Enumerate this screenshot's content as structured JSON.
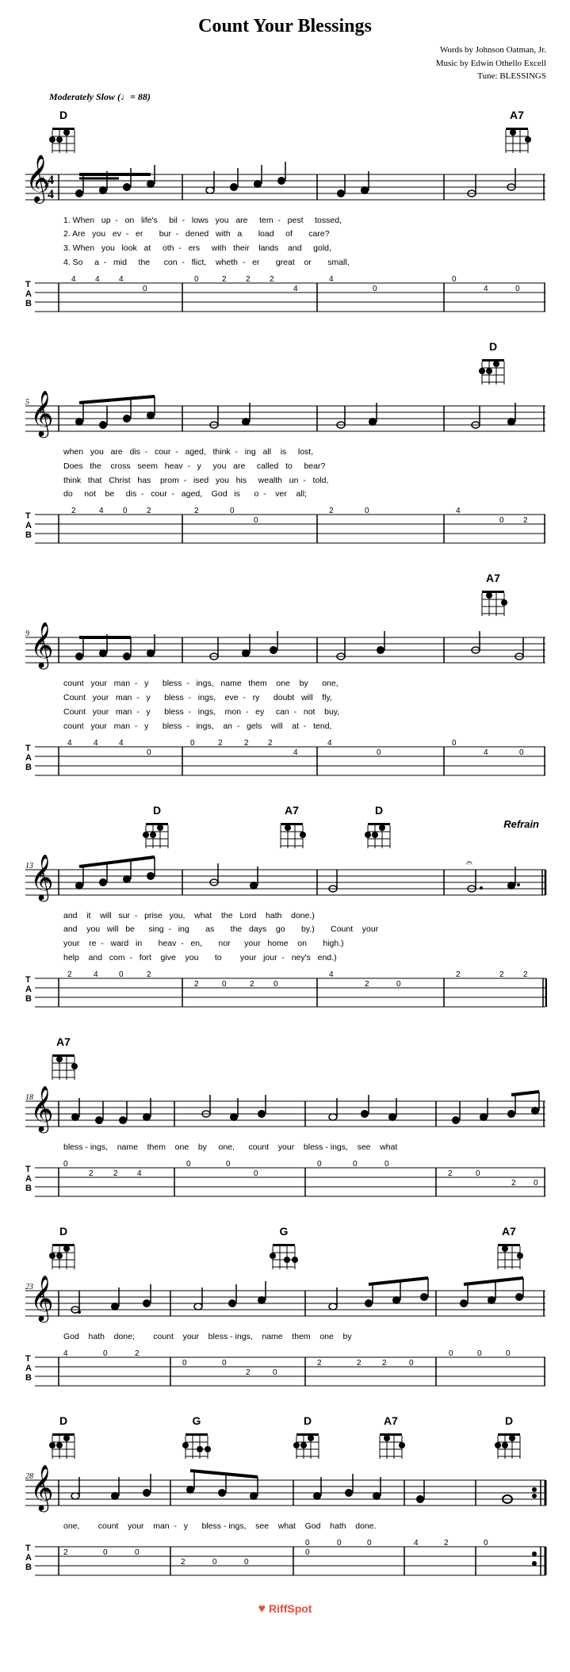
{
  "title": "Count Your Blessings",
  "attribution": {
    "words": "Words by Johnson Oatman, Jr.",
    "music": "Music by Edwin Othello Excell",
    "tune": "Tune: BLESSINGS"
  },
  "tempo": "Moderately Slow (♩= 88)",
  "sections": [
    {
      "id": 1,
      "measure_start": 1,
      "chords_above": [
        {
          "name": "D",
          "position": "left"
        },
        {
          "name": "A7",
          "position": "right"
        }
      ],
      "lyrics": [
        "1. When up - on life's bil - lows you are tem - pest tossed,",
        "2. Are you ev - er bur - dened with a load of care?",
        "3. When you look at oth - ers with their lands and gold,",
        "4. So a - mid the con - flict, wheth - er great or small,"
      ],
      "tab": "4  4  4    0   2  2  2    4    0    4    0"
    },
    {
      "id": 2,
      "measure_start": 5,
      "chords_above": [
        {
          "name": "D",
          "position": "right"
        }
      ],
      "lyrics": [
        "when you are dis - cour - aged, think - ing all is lost,",
        "Does the cross seem heav - y you are called to bear?",
        "think that Christ has prom - ised you his wealth un - told,",
        "do not be dis - cour - aged, God is o - ver all;"
      ],
      "tab": "2  4  0  2    2  0    2  0    4    0    2"
    },
    {
      "id": 3,
      "measure_start": 9,
      "chords_above": [
        {
          "name": "A7",
          "position": "right"
        }
      ],
      "lyrics": [
        "count your man - y bless - ings, name them one by one,",
        "Count your man - y bless - ings, eve - ry doubt will fly,",
        "Count your man - y bless - ings, mon - ey can - not buy,",
        "count your man - y bless - ings, an - gels will at - tend,"
      ],
      "tab": "4  4  4    0   2  2  2    4    0    4    0"
    },
    {
      "id": 4,
      "measure_start": 13,
      "chords_above": [
        {
          "name": "D",
          "position": "left"
        },
        {
          "name": "A7",
          "position": "center"
        },
        {
          "name": "D",
          "position": "right"
        }
      ],
      "section_label": "Refrain",
      "lyrics": [
        "and it will sur - prise you, what the Lord hath done.",
        "and you will be sing - ing as the days go by.",
        "your re - ward in heav - en, nor your home on high.",
        "help and com - fort give you to your jour - ney's end."
      ],
      "extra_lyric": "Count your",
      "tab": "2  4  0  2    2  0    2  0    4  2    0    2  2"
    },
    {
      "id": 5,
      "measure_start": 18,
      "chords_above": [
        {
          "name": "A7",
          "position": "left"
        }
      ],
      "lyrics": [
        "bless - ings, name them one by one, count your bless - ings, see what"
      ],
      "tab": "0    2  2  4    0  0  0    0    0  0  0  2  0"
    },
    {
      "id": 6,
      "measure_start": 23,
      "chords_above": [
        {
          "name": "D",
          "position": "left"
        },
        {
          "name": "G",
          "position": "center"
        },
        {
          "name": "A7",
          "position": "right"
        }
      ],
      "lyrics": [
        "God hath done; count your bless - ings, name them one by"
      ],
      "tab": "4  0    2    0    0    2  0    2  2  2  0  0"
    },
    {
      "id": 7,
      "measure_start": 28,
      "chords_above": [
        {
          "name": "D",
          "position": "far-left"
        },
        {
          "name": "G",
          "position": "left"
        },
        {
          "name": "D",
          "position": "center"
        },
        {
          "name": "A7",
          "position": "right"
        },
        {
          "name": "D",
          "position": "far-right"
        }
      ],
      "lyrics": [
        "one, count your man - y bless - ings, see what God hath done."
      ],
      "tab": "2  0  0    2  0    0    0    4  2  0"
    }
  ],
  "footer": {
    "icon": "♥",
    "brand": "RiffSpot"
  }
}
